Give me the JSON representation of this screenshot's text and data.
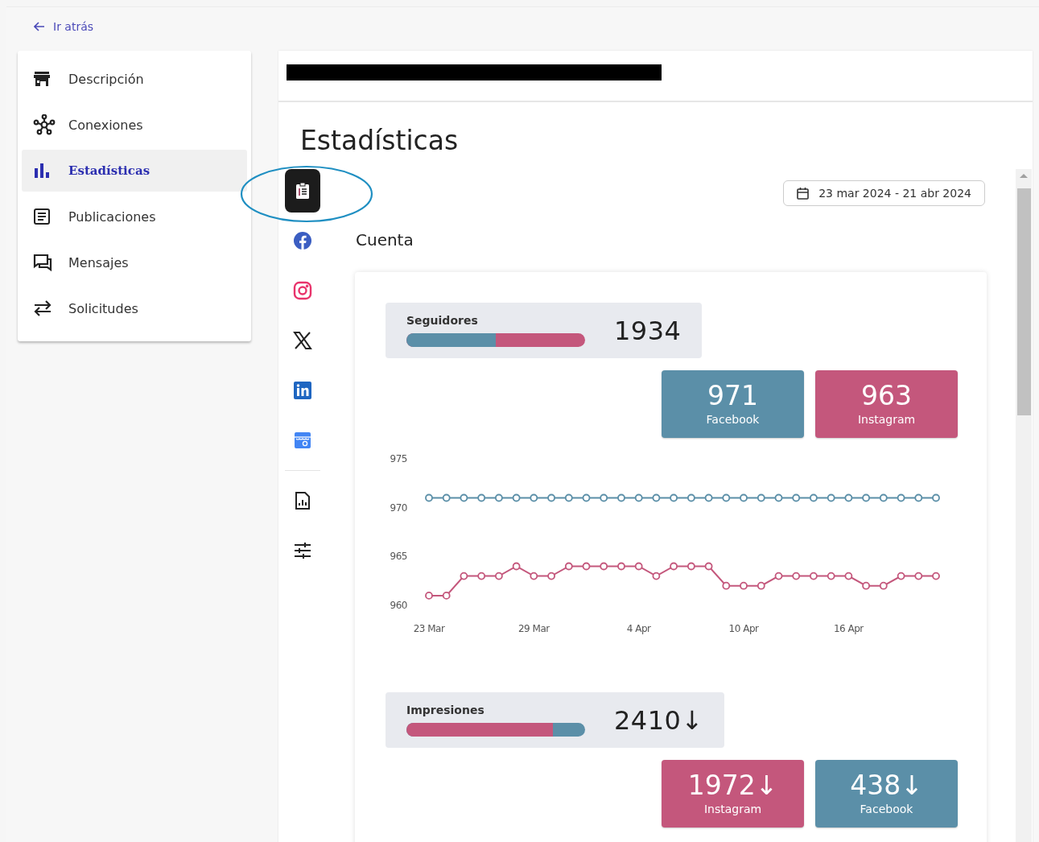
{
  "back_link": {
    "label": "Ir atrás"
  },
  "sidebar": {
    "items": [
      {
        "label": "Descripción",
        "kind": "store",
        "selected": false
      },
      {
        "label": "Conexiones",
        "kind": "network",
        "selected": false
      },
      {
        "label": "Estadísticas",
        "kind": "bars",
        "selected": true
      },
      {
        "label": "Publicaciones",
        "kind": "document",
        "selected": false
      },
      {
        "label": "Mensajes",
        "kind": "chat",
        "selected": false
      },
      {
        "label": "Solicitudes",
        "kind": "swap",
        "selected": false
      }
    ]
  },
  "page_title": "Estadísticas",
  "source_tabs": [
    {
      "kind": "summary",
      "selected": true,
      "highlighted": true
    },
    {
      "kind": "facebook",
      "selected": false,
      "highlighted": false
    },
    {
      "kind": "instagram",
      "selected": false,
      "highlighted": false
    },
    {
      "kind": "x",
      "selected": false,
      "highlighted": false
    },
    {
      "kind": "linkedin",
      "selected": false,
      "highlighted": false
    },
    {
      "kind": "business",
      "selected": false,
      "highlighted": false
    }
  ],
  "tool_tabs": [
    {
      "kind": "report",
      "selected": false
    },
    {
      "kind": "settings",
      "selected": false
    }
  ],
  "date_range": "23 mar 2024 - 21 abr 2024",
  "section_title": "Cuenta",
  "metrics": [
    {
      "title": "Seguidores",
      "total": "1934",
      "level": 0.5,
      "breakdown": [
        {
          "value": "971",
          "label": "Facebook",
          "color": "#5b8fa8"
        },
        {
          "value": "963",
          "label": "Instagram",
          "color": "#c4577c"
        }
      ],
      "chart_data": {
        "type": "line",
        "categories": [
          "23 Mar",
          null,
          null,
          null,
          null,
          null,
          "29 Mar",
          null,
          null,
          null,
          null,
          null,
          "4 Apr",
          null,
          null,
          null,
          null,
          null,
          "10 Apr",
          null,
          null,
          null,
          null,
          null,
          "16 Apr",
          null,
          null,
          null,
          null,
          null
        ],
        "series": [
          {
            "color": "#5b8fa8",
            "marker": "circle",
            "values": [
              971,
              971,
              971,
              971,
              971,
              971,
              971,
              971,
              971,
              971,
              971,
              971,
              971,
              971,
              971,
              971,
              971,
              971,
              971,
              971,
              971,
              971,
              971,
              971,
              971,
              971,
              971,
              971,
              971,
              971
            ]
          },
          {
            "color": "#c4577c",
            "marker": "circle",
            "values": [
              961,
              961,
              963,
              963,
              963,
              964,
              963,
              963,
              964,
              964,
              964,
              964,
              964,
              963,
              964,
              964,
              964,
              962,
              962,
              962,
              963,
              963,
              963,
              963,
              963,
              962,
              962,
              963,
              963,
              963
            ]
          }
        ],
        "ylim": [
          960,
          975
        ],
        "yticks": [
          960,
          965,
          970,
          975
        ]
      }
    },
    {
      "title": "Impresiones",
      "total": "2410↓",
      "level": 0.82,
      "breakdown": [
        {
          "value": "1972↓",
          "label": "Instagram",
          "color": "#c4577c"
        },
        {
          "value": "438↓",
          "label": "Facebook",
          "color": "#5b8fa8"
        }
      ]
    }
  ]
}
